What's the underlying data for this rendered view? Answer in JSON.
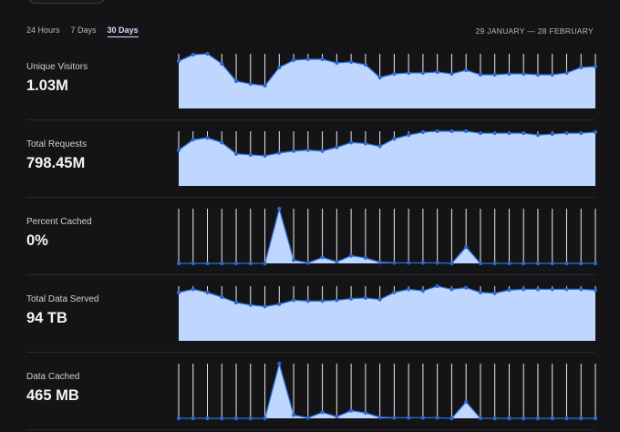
{
  "ranges": [
    "24 Hours",
    "7 Days",
    "30 Days"
  ],
  "active_range": 2,
  "date_range": "29 JANUARY — 28 FEBRUARY",
  "colors": {
    "area": "#bfd6ff",
    "line": "#2f6fd6",
    "point": "#2a6bd4",
    "tick": "#e9e9ec"
  },
  "metrics": [
    {
      "label": "Unique Visitors",
      "value": "1.03M",
      "series": [
        52,
        59,
        60,
        49,
        30,
        27,
        25,
        45,
        53,
        54,
        54,
        50,
        51,
        48,
        34,
        38,
        39,
        39,
        40,
        38,
        42,
        37,
        37,
        38,
        38,
        37,
        37,
        39,
        45,
        46
      ]
    },
    {
      "label": "Total Requests",
      "value": "798.45M",
      "series": [
        38,
        49,
        51,
        46,
        34,
        33,
        32,
        35,
        37,
        38,
        37,
        41,
        46,
        45,
        42,
        50,
        54,
        57,
        58,
        58,
        58,
        56,
        56,
        56,
        56,
        54,
        55,
        56,
        56,
        57
      ]
    },
    {
      "label": "Percent Cached",
      "value": "0%",
      "series": [
        0,
        0,
        0,
        0,
        0,
        0,
        0,
        100,
        6,
        1,
        11,
        3,
        14,
        10,
        2,
        1,
        1,
        1,
        1,
        0,
        30,
        0,
        0,
        0,
        0,
        0,
        0,
        0,
        0,
        0
      ]
    },
    {
      "label": "Total Data Served",
      "value": "94 TB",
      "series": [
        62,
        66,
        62,
        56,
        49,
        46,
        44,
        47,
        52,
        51,
        51,
        52,
        54,
        55,
        53,
        62,
        66,
        64,
        70,
        66,
        68,
        62,
        61,
        65,
        66,
        66,
        66,
        66,
        66,
        65
      ]
    },
    {
      "label": "Data Cached",
      "value": "465 MB",
      "series": [
        0,
        0,
        0,
        0,
        0,
        0,
        0,
        100,
        6,
        1,
        11,
        3,
        14,
        10,
        2,
        1,
        1,
        1,
        1,
        0,
        30,
        0,
        0,
        0,
        0,
        0,
        0,
        0,
        0,
        0
      ]
    }
  ]
}
